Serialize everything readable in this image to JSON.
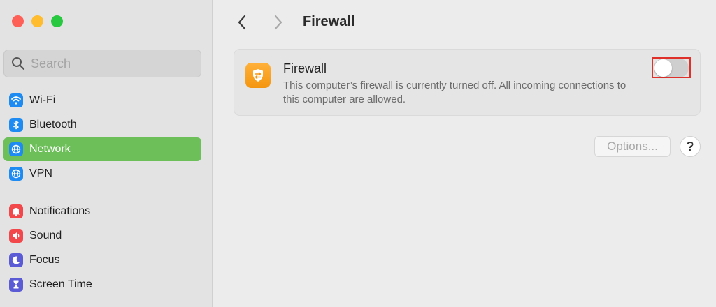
{
  "sidebar": {
    "search": {
      "placeholder": "Search"
    },
    "items": [
      {
        "label": "Wi-Fi",
        "icon": "wifi-icon",
        "color": "#1e8bf2"
      },
      {
        "label": "Bluetooth",
        "icon": "bluetooth-icon",
        "color": "#1e8bf2"
      },
      {
        "label": "Network",
        "icon": "globe-icon",
        "color": "#1e8bf2",
        "active": true
      },
      {
        "label": "VPN",
        "icon": "globe-icon",
        "color": "#1e8bf2"
      },
      {
        "label": "Notifications",
        "icon": "bell-icon",
        "color": "#f2474b"
      },
      {
        "label": "Sound",
        "icon": "speaker-icon",
        "color": "#f2474b"
      },
      {
        "label": "Focus",
        "icon": "moon-icon",
        "color": "#5b5bd6"
      },
      {
        "label": "Screen Time",
        "icon": "hourglass-icon",
        "color": "#5b5bd6"
      }
    ],
    "active_color": "#6cbf59"
  },
  "header": {
    "title": "Firewall"
  },
  "firewall": {
    "title": "Firewall",
    "description": "This computer’s firewall is currently turned off. All incoming connections to this computer are allowed.",
    "enabled": false,
    "icon": "firewall-shield-icon",
    "icon_color": "#f7a21b"
  },
  "buttons": {
    "options": "Options...",
    "help": "?"
  }
}
